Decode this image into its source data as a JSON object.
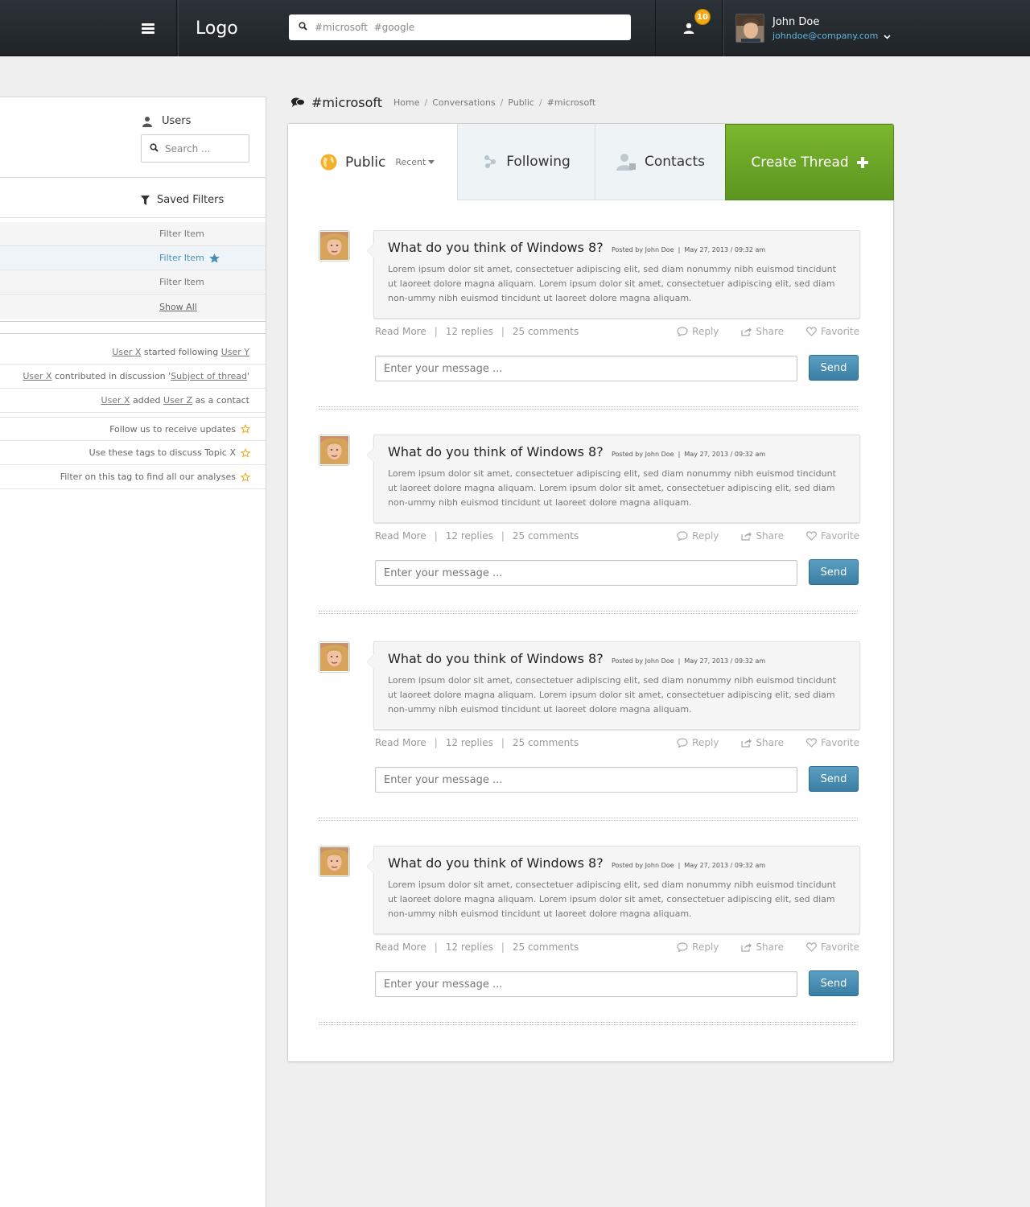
{
  "header": {
    "logo": "Logo",
    "search_placeholder": "#microsoft  #google",
    "notification_count": "10",
    "user": {
      "name": "John Doe",
      "email": "johndoe@company.com"
    }
  },
  "sidebar": {
    "users_label": "Users",
    "search_placeholder": "Search ...",
    "saved_filters_label": "Saved Filters",
    "filters": [
      "Filter Item",
      "Filter Item",
      "Filter Item"
    ],
    "show_all": "Show All",
    "activity": [
      {
        "a": "User X",
        "b": " started following ",
        "c": "User Y",
        "d": ""
      },
      {
        "a": "User X",
        "b": " contributed in discussion '",
        "c": "Subject of thread",
        "d": "'"
      },
      {
        "a": "User X",
        "b": " added ",
        "c": "User Z",
        "d": " as a contact"
      }
    ],
    "tips": [
      "Follow us to receive updates",
      "Use these tags to discuss Topic X",
      "Filter on this tag to find all our analyses"
    ]
  },
  "breadcrumb": {
    "title": "#microsoft",
    "items": [
      "Home",
      "Conversations",
      "Public",
      "#microsoft"
    ],
    "sep": "/"
  },
  "tabs": {
    "public": "Public",
    "recent": "Recent",
    "following": "Following",
    "contacts": "Contacts",
    "create": "Create Thread"
  },
  "post_template": {
    "title": "What do you think of Windows 8?",
    "meta": "Posted by John Doe  |  May 27, 2013 / 09:32 am",
    "body": "Lorem ipsum dolor sit amet, consectetuer adipiscing elit, sed diam nonummy nibh euismod tincidunt ut laoreet dolore magna aliquam. Lorem ipsum dolor sit amet, consectetuer adipiscing elit, sed diam non-ummy nibh euismod tincidunt ut laoreet dolore magna aliquam.",
    "read_more": "Read More",
    "replies": "12 replies",
    "comments": "25 comments",
    "reply": "Reply",
    "share": "Share",
    "favorite": "Favorite",
    "reply_placeholder": "Enter your message ...",
    "send": "Send"
  },
  "posts": [
    {
      "title": "What do you think of Windows 8?",
      "meta": "Posted by John Doe  |  May 27, 2013 / 09:32 am",
      "body": "Lorem ipsum dolor sit amet, consectetuer adipiscing elit, sed diam nonummy nibh euismod tincidunt ut laoreet dolore magna aliquam. Lorem ipsum dolor sit amet, consectetuer adipiscing elit, sed diam non-ummy nibh euismod tincidunt ut laoreet dolore magna aliquam."
    },
    {
      "title": "What do you think of Windows 8?",
      "meta": "Posted by John Doe  |  May 27, 2013 / 09:32 am",
      "body": "Lorem ipsum dolor sit amet, consectetuer adipiscing elit, sed diam nonummy nibh euismod tincidunt ut laoreet dolore magna aliquam. Lorem ipsum dolor sit amet, consectetuer adipiscing elit, sed diam non-ummy nibh euismod tincidunt ut laoreet dolore magna aliquam."
    },
    {
      "title": "What do you think of Windows 8?",
      "meta": "Posted by John Doe  |  May 27, 2013 / 09:32 am",
      "body": "Lorem ipsum dolor sit amet, consectetuer adipiscing elit, sed diam nonummy nibh euismod tincidunt ut laoreet dolore magna aliquam. Lorem ipsum dolor sit amet, consectetuer adipiscing elit, sed diam non-ummy nibh euismod tincidunt ut laoreet dolore magna aliquam."
    },
    {
      "title": "What do you think of Windows 8?",
      "meta": "Posted by John Doe  |  May 27, 2013 / 09:32 am",
      "body": "Lorem ipsum dolor sit amet, consectetuer adipiscing elit, sed diam nonummy nibh euismod tincidunt ut laoreet dolore magna aliquam. Lorem ipsum dolor sit amet, consectetuer adipiscing elit, sed diam non-ummy nibh euismod tincidunt ut laoreet dolore magna aliquam."
    }
  ],
  "colors": {
    "accent_green": "#6aa827",
    "send_blue": "#4a8fb5",
    "badge": "#f2a912",
    "link_blue": "#4a8db7"
  }
}
